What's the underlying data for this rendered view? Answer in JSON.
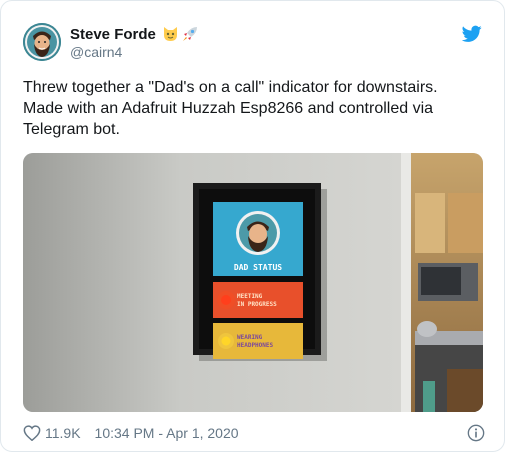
{
  "author": {
    "name": "Steve Forde",
    "handle": "@cairn4",
    "emojis": [
      "cat-face-emoji",
      "rocket-emoji"
    ]
  },
  "tweet": {
    "lines": [
      "Threw together a \"Dad's on a call\" indicator for downstairs.",
      "Made with an Adafruit Huzzah Esp8266 and controlled via",
      "Telegram bot."
    ]
  },
  "photo": {
    "sign_title": "DAD STATUS",
    "status_rows": [
      {
        "line1": "MEETING",
        "line2": "IN PROGRESS",
        "led_color": "#ff2a1a",
        "bg": "#e8502b"
      },
      {
        "line1": "WEARING",
        "line2": "HEADPHONES",
        "led_color": "#ffcc00",
        "bg": "#e7b83a"
      }
    ]
  },
  "footer": {
    "likes": "11.9K",
    "timestamp": "10:34 PM - Apr 1, 2020"
  },
  "colors": {
    "brand_blue": "#1da1f2",
    "muted": "#657786",
    "text": "#14171a"
  }
}
